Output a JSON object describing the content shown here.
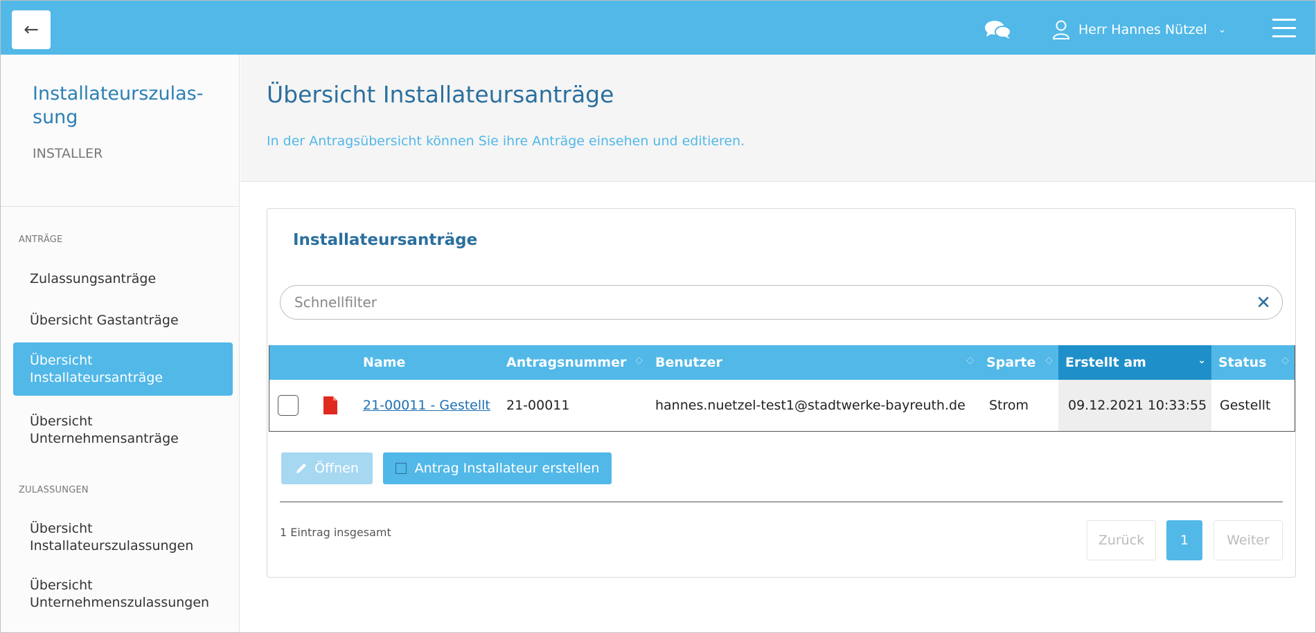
{
  "topbar": {
    "back_icon": "←",
    "user_name": "Herr Hannes Nützel",
    "user_chevron": "⌄"
  },
  "sidebar": {
    "title": "Installateurszulas-sung",
    "title_line1": "Installateurszulas-",
    "title_line2": "sung",
    "subtitle": "INSTALLER",
    "sections": [
      {
        "label": "ANTRÄGE",
        "items": [
          {
            "line1": "Zulassungsanträge",
            "line2": ""
          },
          {
            "line1": "Übersicht Gastanträge",
            "line2": ""
          },
          {
            "line1": "Übersicht",
            "line2": "Installateursanträge",
            "active": true
          },
          {
            "line1": "Übersicht",
            "line2": "Unternehmensanträge"
          }
        ]
      },
      {
        "label": "ZULASSUNGEN",
        "items": [
          {
            "line1": "Übersicht",
            "line2": "Installateurszulassungen"
          },
          {
            "line1": "Übersicht",
            "line2": "Unternehmenszulassungen"
          }
        ]
      }
    ]
  },
  "main": {
    "title": "Übersicht Installateursanträge",
    "description": "In der Antragsübersicht können Sie ihre Anträge einsehen und editieren."
  },
  "card": {
    "title": "Installateursanträge",
    "filter_placeholder": "Schnellfilter",
    "filter_clear": "✕",
    "columns": [
      "Name",
      "Antragsnummer",
      "Benutzer",
      "Sparte",
      "Erstellt am",
      "Status"
    ],
    "sorted_column": "Erstellt am",
    "rows": [
      {
        "name": "21-00011 - Gestellt",
        "antragsnummer": "21-00011",
        "benutzer": "hannes.nuetzel-test1@stadtwerke-bayreuth.de",
        "sparte": "Strom",
        "erstellt_am": "09.12.2021 10:33:55",
        "status": "Gestellt"
      }
    ],
    "open_button": "Öffnen",
    "create_button": "Antrag Installateur erstellen",
    "total_text": "1 Eintrag insgesamt",
    "pagination": {
      "prev": "Zurück",
      "current": "1",
      "next": "Weiter"
    }
  },
  "colors": {
    "accent": "#51b8e8",
    "accent_dark": "#1f8fc9",
    "title_blue": "#2b6f9e",
    "pdf_red": "#e02a1f"
  }
}
